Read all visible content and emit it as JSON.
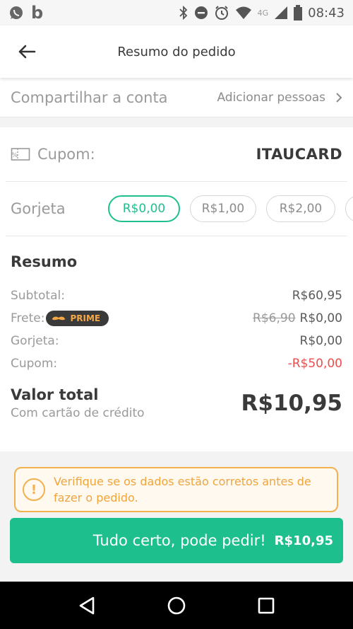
{
  "status_bar": {
    "time": "08:43",
    "network": "4G",
    "icons": [
      "whatsapp-icon",
      "b-app-icon",
      "bluetooth-icon",
      "do-not-disturb-icon",
      "alarm-icon",
      "wifi-icon",
      "signal-icon",
      "battery-icon"
    ],
    "b_glyph": "b"
  },
  "header": {
    "title": "Resumo do pedido",
    "back_icon": "arrow-left-icon"
  },
  "share": {
    "label": "Compartilhar a conta",
    "action": "Adicionar pessoas"
  },
  "coupon": {
    "icon": "percent-ticket-icon",
    "label": "Cupom:",
    "code": "ITAUCARD"
  },
  "tip": {
    "label": "Gorjeta",
    "options": [
      "R$0,00",
      "R$1,00",
      "R$2,00"
    ],
    "selected": "R$0,00"
  },
  "summary": {
    "title": "Resumo",
    "subtotal_label": "Subtotal:",
    "subtotal_value": "R$60,95",
    "delivery_label": "Frete:",
    "prime_badge": "PRIME",
    "delivery_old": "R$6,90",
    "delivery_value": "R$0,00",
    "tip_label": "Gorjeta:",
    "tip_value": "R$0,00",
    "coupon_label": "Cupom:",
    "coupon_value": "-R$50,00",
    "total_label": "Valor total",
    "total_sub": "Com cartão de crédito",
    "total_value": "R$10,95"
  },
  "warning": {
    "icon_glyph": "!",
    "text": "Verifique se os dados estão corretos antes de fazer o pedido."
  },
  "confirm": {
    "label": "Tudo certo, pode pedir!",
    "amount": "R$10,95"
  },
  "colors": {
    "accent": "#1dbf8d",
    "warning": "#f3b04f",
    "negative": "#ec4e4e"
  }
}
